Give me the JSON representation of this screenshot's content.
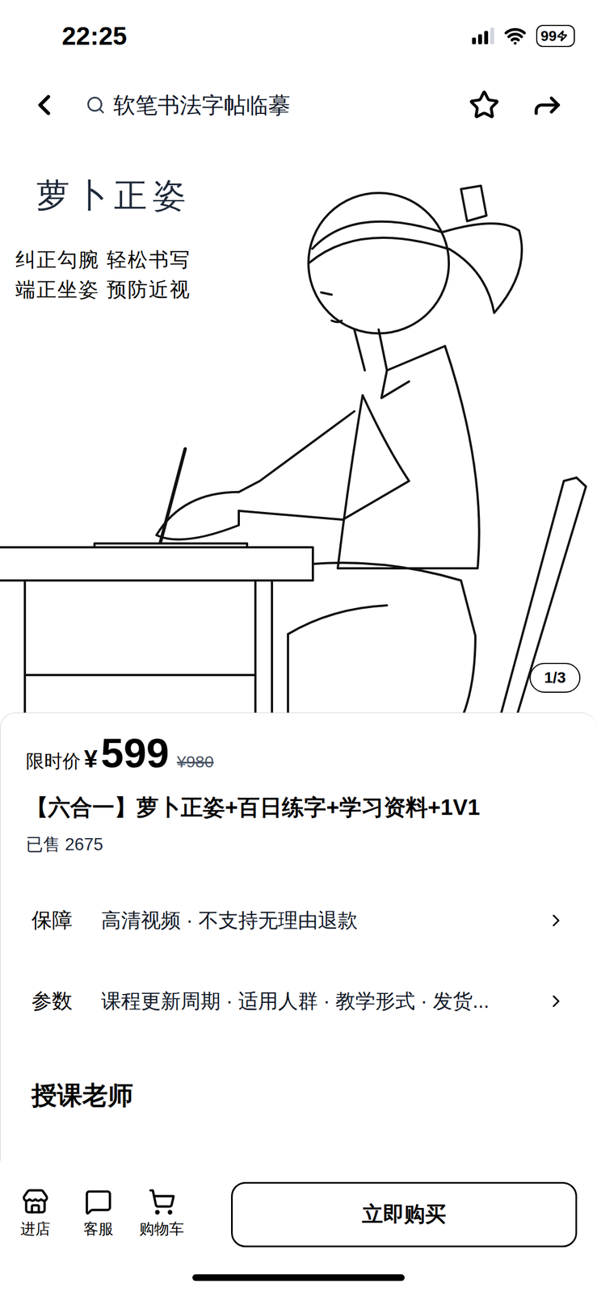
{
  "status_bar": {
    "time": "22:25",
    "battery": "99"
  },
  "nav": {
    "search": "软笔书法字帖临摹"
  },
  "hero": {
    "title": "萝卜正姿",
    "lines": [
      "纠正勾腕 轻松书写",
      "端正坐姿 预防近视"
    ],
    "counter": "1/3"
  },
  "price": {
    "label": "限时价",
    "currency": "¥",
    "value": "599",
    "original": "¥980"
  },
  "product": {
    "title": "【六合一】萝卜正姿+百日练字+学习资料+1V1",
    "sold": "已售 2675"
  },
  "rows": [
    {
      "label": "保障",
      "value": "高清视频 · 不支持无理由退款"
    },
    {
      "label": "参数",
      "value": "课程更新周期 · 适用人群 · 教学形式 · 发货..."
    }
  ],
  "section": {
    "title": "授课老师"
  },
  "bottom_bar": {
    "actions": [
      {
        "label": "进店"
      },
      {
        "label": "客服"
      },
      {
        "label": "购物车"
      }
    ],
    "buy": "立即购买"
  }
}
